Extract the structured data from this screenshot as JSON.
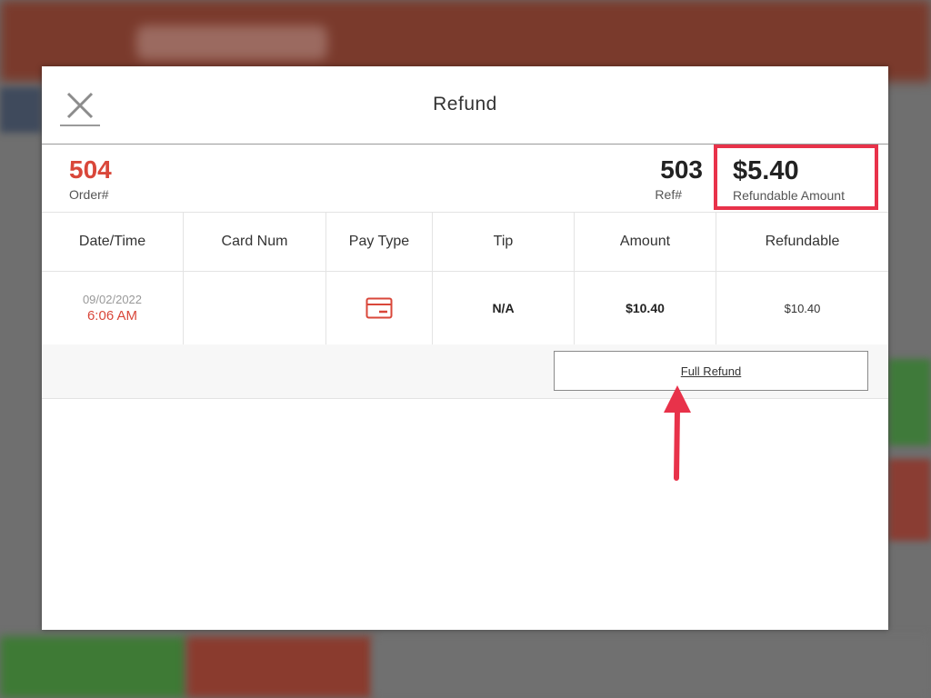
{
  "modal": {
    "title": "Refund",
    "close_icon": "close-icon"
  },
  "order": {
    "number": "504",
    "number_label": "Order#",
    "ref": "503",
    "ref_label": "Ref#",
    "refundable_amount": "$5.40",
    "refundable_label": "Refundable Amount"
  },
  "table": {
    "headers": [
      "Date/Time",
      "Card Num",
      "Pay Type",
      "Tip",
      "Amount",
      "Refundable"
    ],
    "rows": [
      {
        "date": "09/02/2022",
        "time": "6:06 AM",
        "card_num": "",
        "pay_type_icon": "credit-card-icon",
        "tip": "N/A",
        "amount": "$10.40",
        "refundable": "$10.40"
      }
    ]
  },
  "actions": {
    "full_refund_label": "Full Refund"
  },
  "colors": {
    "accent_red": "#d9473a",
    "highlight_box": "#e8324a",
    "annotation_arrow": "#e8324a"
  }
}
